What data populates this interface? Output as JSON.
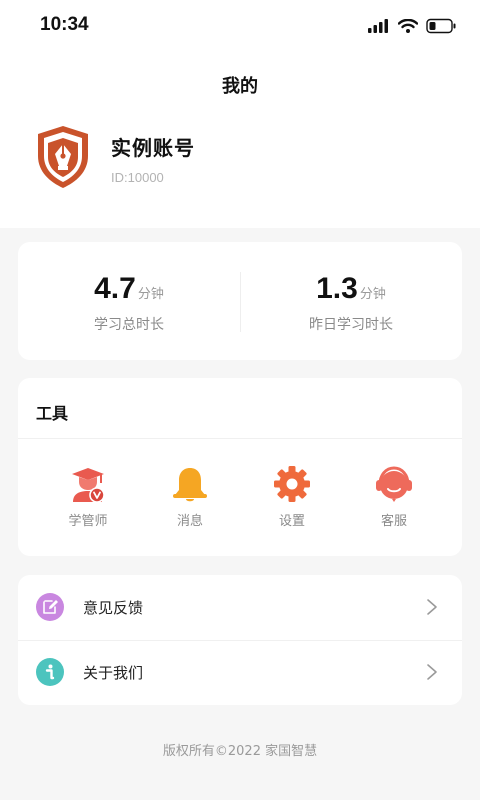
{
  "status_bar": {
    "time": "10:34",
    "icons": [
      "signal-icon",
      "wifi-icon",
      "battery-icon"
    ]
  },
  "header": {
    "title": "我的"
  },
  "profile": {
    "name": "实例账号",
    "id_prefix": "ID:",
    "id_value": "10000",
    "logo_icon": "pen-shield-logo-icon",
    "logo_color": "#c9532b"
  },
  "stats": [
    {
      "value": "4.7",
      "unit": "分钟",
      "label": "学习总时长"
    },
    {
      "value": "1.3",
      "unit": "分钟",
      "label": "昨日学习时长"
    }
  ],
  "tools": {
    "title": "工具",
    "items": [
      {
        "label": "学管师",
        "icon": "graduate-advisor-icon",
        "color": "#e95a4f"
      },
      {
        "label": "消息",
        "icon": "bell-icon",
        "color": "#f5a623"
      },
      {
        "label": "设置",
        "icon": "gear-icon",
        "color": "#ef6a3c"
      },
      {
        "label": "客服",
        "icon": "headset-icon",
        "color": "#ee6a5b"
      }
    ]
  },
  "menu": [
    {
      "label": "意见反馈",
      "icon": "edit-feedback-icon",
      "color": "#c987e0"
    },
    {
      "label": "关于我们",
      "icon": "info-icon",
      "color": "#4cc4be"
    }
  ],
  "footer": {
    "copyright": "版权所有©2022 家国智慧"
  }
}
